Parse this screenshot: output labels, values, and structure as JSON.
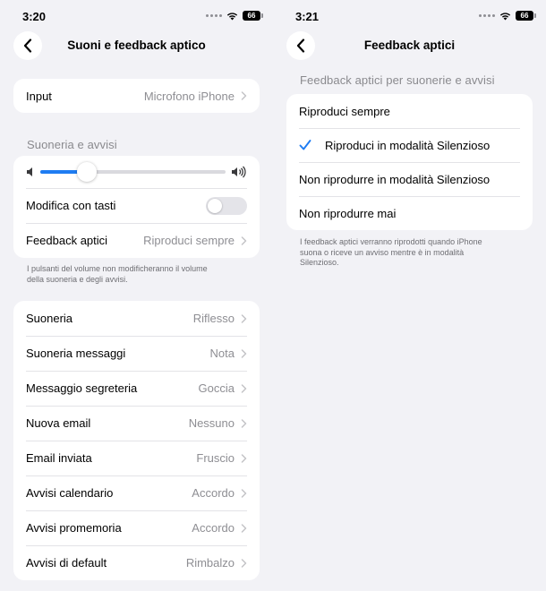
{
  "left": {
    "status": {
      "time": "3:20",
      "battery": "66"
    },
    "nav": {
      "title": "Suoni e feedback aptico"
    },
    "input_row": {
      "label": "Input",
      "value": "Microfono iPhone"
    },
    "ringer_section": {
      "header": "Suoneria e avvisi",
      "volume_level": 0.25,
      "modify_with_buttons": {
        "label": "Modifica con tasti",
        "on": false
      },
      "haptics_row": {
        "label": "Feedback aptici",
        "value": "Riproduci sempre"
      },
      "footnote_line1": "I pulsanti del volume non modificheranno il volume",
      "footnote_line2": "della suoneria e degli avvisi."
    },
    "sounds": [
      {
        "label": "Suoneria",
        "value": "Riflesso"
      },
      {
        "label": "Suoneria messaggi",
        "value": "Nota"
      },
      {
        "label": "Messaggio segreteria",
        "value": "Goccia"
      },
      {
        "label": "Nuova email",
        "value": "Nessuno"
      },
      {
        "label": "Email inviata",
        "value": "Fruscio"
      },
      {
        "label": "Avvisi calendario",
        "value": "Accordo"
      },
      {
        "label": "Avvisi promemoria",
        "value": "Accordo"
      },
      {
        "label": "Avvisi di default",
        "value": "Rimbalzo"
      }
    ]
  },
  "right": {
    "status": {
      "time": "3:21",
      "battery": "66"
    },
    "nav": {
      "title": "Feedback aptici"
    },
    "section_header": "Feedback aptici per suonerie e avvisi",
    "options": [
      {
        "label": "Riproduci sempre",
        "selected": false
      },
      {
        "label": "Riproduci in modalità Silenzioso",
        "selected": true
      },
      {
        "label": "Non riprodurre in modalità Silenzioso",
        "selected": false
      },
      {
        "label": "Non riprodurre mai",
        "selected": false
      }
    ],
    "footnote_line1": "I feedback aptici verranno riprodotti quando iPhone",
    "footnote_line2": "suona o riceve un avviso mentre è in modalità",
    "footnote_line3": "Silenzioso."
  },
  "colors": {
    "accent": "#1e7cf2",
    "background": "#f2f2f6",
    "secondary_text": "#8e8e93"
  },
  "icons": {
    "back": "chevron-left-icon",
    "disclosure": "chevron-right-icon",
    "check": "checkmark-icon",
    "volume_low": "speaker-low-icon",
    "volume_high": "speaker-high-icon",
    "wifi": "wifi-icon",
    "battery": "battery-icon"
  }
}
